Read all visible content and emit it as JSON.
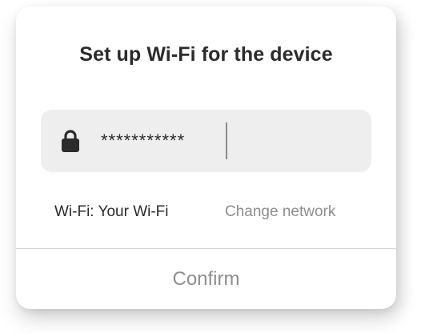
{
  "dialog": {
    "title": "Set up Wi-Fi for the device",
    "password_field": {
      "value": "***********",
      "icon": "lock-icon"
    },
    "wifi_label": "Wi-Fi: Your Wi-Fi",
    "change_network_label": "Change network",
    "confirm_label": "Confirm"
  },
  "colors": {
    "text_primary": "#2b2b2b",
    "text_muted": "#8d8d8d",
    "field_background": "#eeeeee"
  }
}
